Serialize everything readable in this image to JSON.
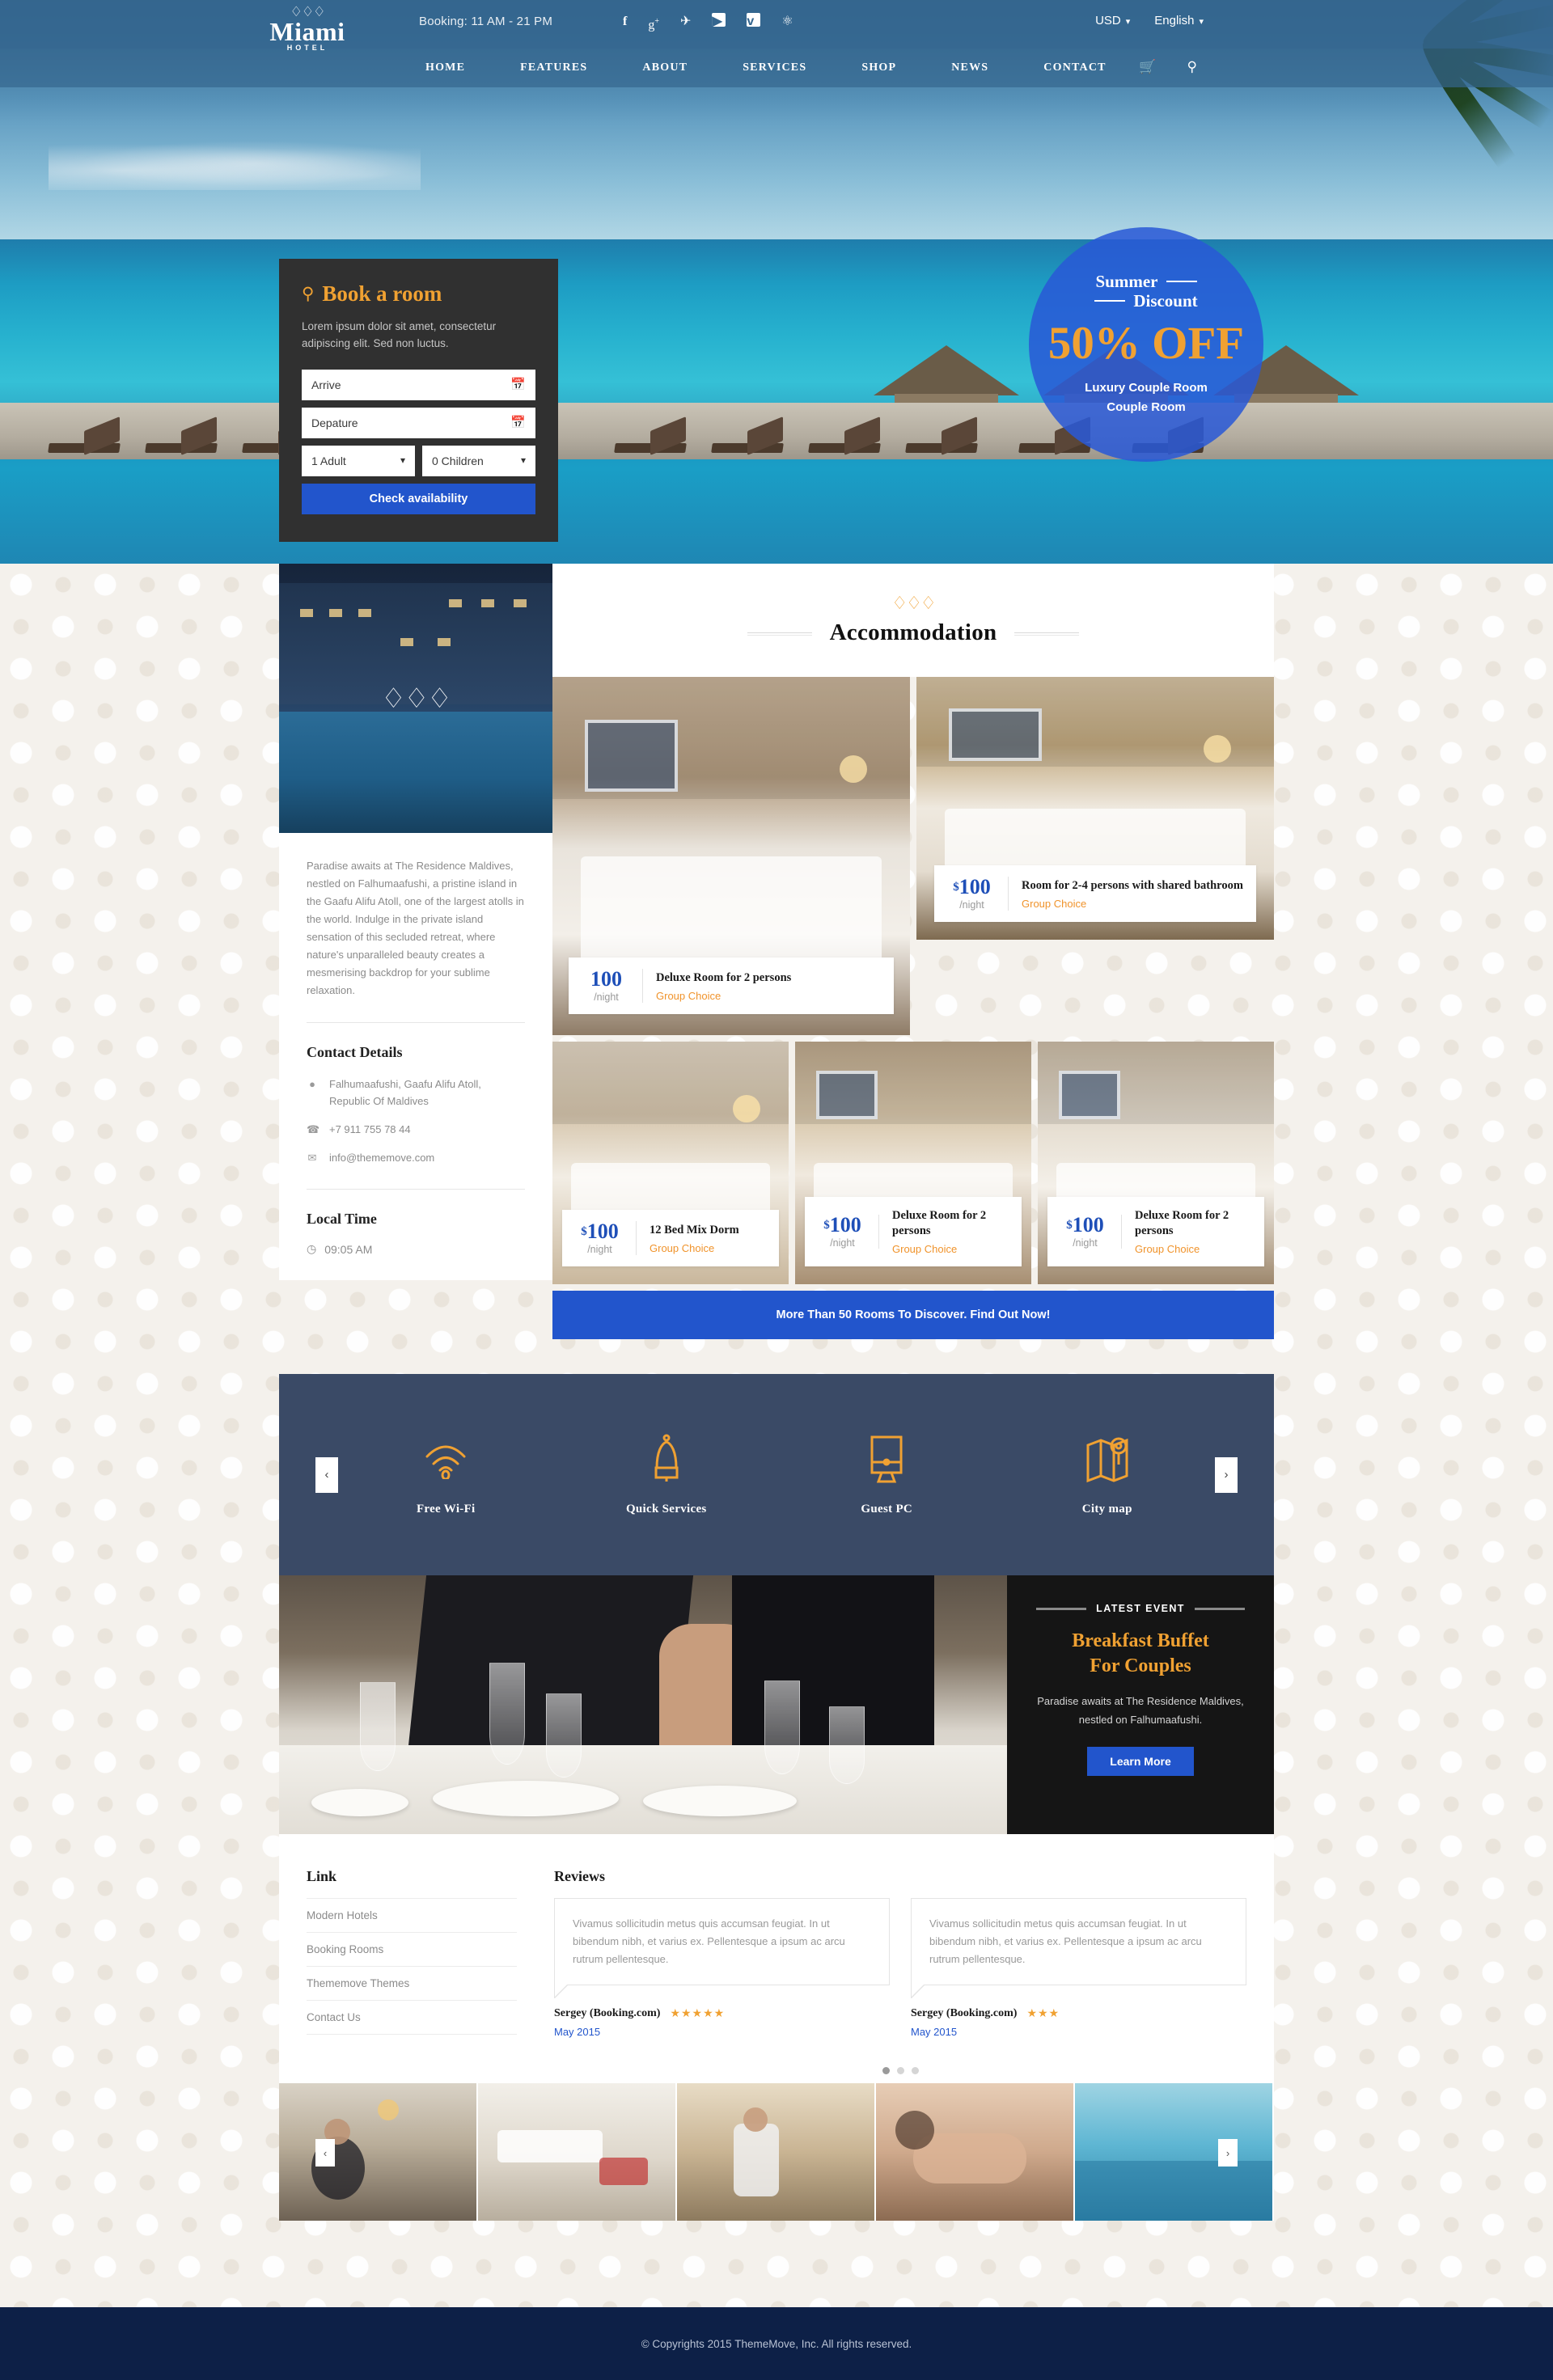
{
  "brand": {
    "name": "Miami",
    "tagline": "HOTEL",
    "crown_icon": "crown-icon"
  },
  "topbar": {
    "booking_hours": "Booking: 11 AM - 21 PM",
    "social": [
      {
        "name": "facebook-icon",
        "glyph": "f"
      },
      {
        "name": "google-plus-icon",
        "glyph": "g+"
      },
      {
        "name": "twitter-icon",
        "glyph": "✈"
      },
      {
        "name": "youtube-icon",
        "glyph": "▶"
      },
      {
        "name": "vimeo-icon",
        "glyph": "v"
      },
      {
        "name": "dribbble-icon",
        "glyph": "⊛"
      }
    ],
    "currency": "USD",
    "language": "English"
  },
  "nav": {
    "items": [
      "HOME",
      "FEATURES",
      "ABOUT",
      "SERVICES",
      "SHOP",
      "NEWS",
      "CONTACT"
    ],
    "cart_icon": "shopping-cart-icon",
    "search_icon": "search-icon"
  },
  "booking_form": {
    "title": "Book a room",
    "search_icon": "magnifier-icon",
    "description": "Lorem ipsum dolor sit amet, consectetur adipiscing elit. Sed non luctus.",
    "arrive_placeholder": "Arrive",
    "departure_placeholder": "Depature",
    "adults_value": "1 Adult",
    "children_value": "0 Children",
    "submit_label": "Check availability",
    "calendar_icon": "calendar-icon"
  },
  "discount_badge": {
    "line1": "Summer",
    "line2": "Discount",
    "percent": "50% OFF",
    "rooms": [
      "Luxury Couple Room",
      "Couple Room"
    ]
  },
  "sidebar": {
    "intro": "Paradise awaits at The Residence Maldives, nestled on Falhumaafushi, a pristine island in the Gaafu Alifu Atoll, one of the largest atolls in the world. Indulge in the private island sensation of this secluded retreat, where nature's unparalleled beauty creates a mesmerising backdrop for your sublime relaxation.",
    "contact_title": "Contact Details",
    "address": "Falhumaafushi, Gaafu Alifu Atoll, Republic Of Maldives",
    "phone": "+7 911 755 78 44",
    "email": "info@thememove.com",
    "local_time_title": "Local Time",
    "local_time": "09:05 AM",
    "icons": {
      "location": "map-pin-icon",
      "phone": "phone-icon",
      "email": "envelope-icon",
      "clock": "clock-icon"
    }
  },
  "accommodation": {
    "title": "Accommodation",
    "crown_icon": "crown-icon",
    "rooms": [
      {
        "price": "100",
        "currency": "",
        "per": "/night",
        "name": "Deluxe Room for 2 persons",
        "tag": "Group Choice"
      },
      {
        "price": "100",
        "currency": "$",
        "per": "/night",
        "name": "Room for 2-4 persons with shared bathroom",
        "tag": "Group Choice"
      },
      {
        "price": "100",
        "currency": "$",
        "per": "/night",
        "name": "12 Bed Mix Dorm",
        "tag": "Group Choice"
      },
      {
        "price": "100",
        "currency": "$",
        "per": "/night",
        "name": "Deluxe Room for 2 persons",
        "tag": "Group Choice"
      },
      {
        "price": "100",
        "currency": "$",
        "per": "/night",
        "name": "Deluxe Room for 2 persons",
        "tag": "Group Choice"
      }
    ],
    "more_label": "More Than 50 Rooms To Discover. Find Out Now!"
  },
  "services": {
    "prev_label": "‹",
    "next_label": "›",
    "items": [
      {
        "label": "Free Wi-Fi",
        "icon": "wifi-icon"
      },
      {
        "label": "Quick Services",
        "icon": "bell-icon"
      },
      {
        "label": "Guest PC",
        "icon": "monitor-icon"
      },
      {
        "label": "City map",
        "icon": "map-icon"
      }
    ]
  },
  "event": {
    "kicker": "LATEST EVENT",
    "title_line1": "Breakfast Buffet",
    "title_line2": "For Couples",
    "description": "Paradise awaits at The Residence Maldives, nestled on Falhumaafushi.",
    "button_label": "Learn More"
  },
  "links": {
    "title": "Link",
    "items": [
      "Modern Hotels",
      "Booking Rooms",
      "Thememove Themes",
      "Contact Us"
    ]
  },
  "reviews": {
    "title": "Reviews",
    "items": [
      {
        "text": "Vivamus sollicitudin metus quis accumsan feugiat. In ut bibendum nibh, et varius ex. Pellentesque a ipsum ac arcu rutrum pellentesque.",
        "author": "Sergey (Booking.com)",
        "stars": "★★★★★",
        "date": "May 2015"
      },
      {
        "text": "Vivamus sollicitudin metus quis accumsan feugiat. In ut bibendum nibh, et varius ex. Pellentesque a ipsum ac arcu rutrum pellentesque.",
        "author": "Sergey (Booking.com)",
        "stars": "★★★",
        "date": "May 2015"
      }
    ],
    "pagination": [
      true,
      false,
      false
    ]
  },
  "gallery": {
    "prev_label": "‹",
    "next_label": "›"
  },
  "footer": {
    "copyright": "© Copyrights 2015 ThemeMove, Inc. All rights reserved."
  },
  "colors": {
    "accent_orange": "#f0a132",
    "accent_blue": "#2255cc",
    "header_blue": "#34668f",
    "services_navy": "#3a4a66",
    "footer_navy": "#0d2047"
  }
}
